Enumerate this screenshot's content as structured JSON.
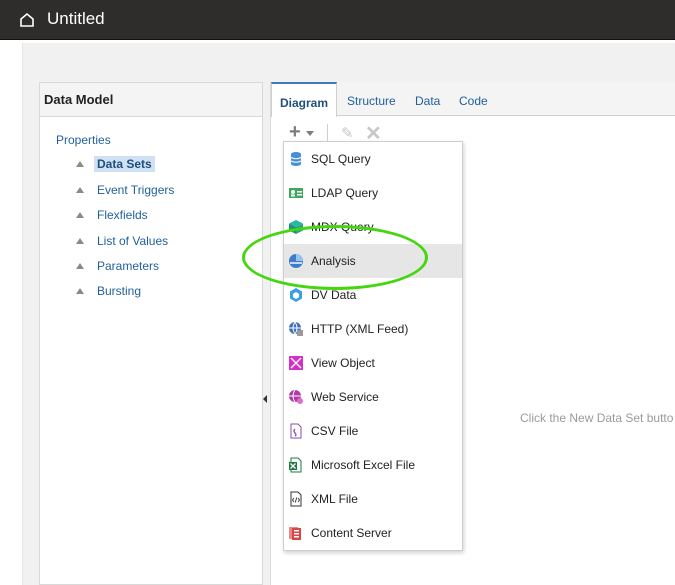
{
  "app": {
    "title": "Untitled"
  },
  "left_panel": {
    "header": "Data Model",
    "properties_label": "Properties",
    "items": [
      {
        "label": "Data Sets",
        "selected": true
      },
      {
        "label": "Event Triggers"
      },
      {
        "label": "Flexfields"
      },
      {
        "label": "List of Values"
      },
      {
        "label": "Parameters"
      },
      {
        "label": "Bursting"
      }
    ]
  },
  "tabs": [
    {
      "label": "Diagram",
      "active": true
    },
    {
      "label": "Structure"
    },
    {
      "label": "Data"
    },
    {
      "label": "Code"
    }
  ],
  "toolbar": {
    "new_icon": "plus-icon",
    "edit_icon": "pencil-icon",
    "delete_icon": "close-icon"
  },
  "menu": {
    "items": [
      {
        "label": "SQL Query",
        "icon": "database-icon"
      },
      {
        "label": "LDAP Query",
        "icon": "ldap-icon"
      },
      {
        "label": "MDX Query",
        "icon": "cube-icon"
      },
      {
        "label": "Analysis",
        "icon": "analysis-icon",
        "highlighted": true
      },
      {
        "label": "DV Data",
        "icon": "hexagon-icon"
      },
      {
        "label": "HTTP (XML Feed)",
        "icon": "globe-icon"
      },
      {
        "label": "View Object",
        "icon": "view-object-icon"
      },
      {
        "label": "Web Service",
        "icon": "web-service-icon"
      },
      {
        "label": "CSV File",
        "icon": "csv-file-icon"
      },
      {
        "label": "Microsoft Excel File",
        "icon": "excel-file-icon"
      },
      {
        "label": "XML File",
        "icon": "xml-file-icon"
      },
      {
        "label": "Content Server",
        "icon": "content-server-icon"
      }
    ]
  },
  "hint_text": "Click the New Data Set butto",
  "colors": {
    "accent": "#3a78c2",
    "link": "#1f5f9c",
    "annotation": "#44d60f",
    "topbar": "#2f2d2c"
  }
}
